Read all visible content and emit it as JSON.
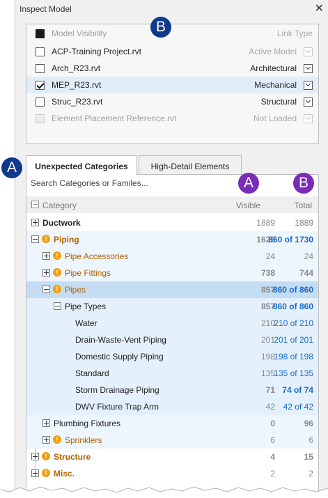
{
  "window": {
    "title": "Inspect Model",
    "close": "✕"
  },
  "models": {
    "header": {
      "label": "Model Visibility",
      "type": "Link Type"
    },
    "items": [
      {
        "name": "ACP-Training Project.rvt",
        "type": "Active Model"
      },
      {
        "name": "Arch_R23.rvt",
        "type": "Architectural"
      },
      {
        "name": "MEP_R23.rvt",
        "type": "Mechanical"
      },
      {
        "name": "Struc_R23.rvt",
        "type": "Structural"
      },
      {
        "name": "Element Placement Reference.rvt",
        "type": "Not Loaded"
      }
    ]
  },
  "tabs": [
    "Unexpected Categories",
    "High-Detail Elements"
  ],
  "search": {
    "placeholder": "Search Categories or Familes..."
  },
  "columns": {
    "category": "Category",
    "visible": "Visible",
    "total": "Total"
  },
  "rows": [
    {
      "label": "Ductwork",
      "visible": "1889",
      "total": "1889"
    },
    {
      "label": "Piping",
      "visible": "1625",
      "total": "860 of 1730"
    },
    {
      "label": "Pipe Accessories",
      "visible": "24",
      "total": "24"
    },
    {
      "label": "Pipe Fittings",
      "visible": "738",
      "total": "744"
    },
    {
      "label": "Pipes",
      "visible": "857",
      "total": "860 of 860"
    },
    {
      "label": "Pipe Types",
      "visible": "857",
      "total": "860 of 860"
    },
    {
      "label": "Water",
      "visible": "210",
      "total": "210 of 210"
    },
    {
      "label": "Drain-Waste-Vent Piping",
      "visible": "201",
      "total": "201 of 201"
    },
    {
      "label": "Domestic Supply Piping",
      "visible": "198",
      "total": "198 of 198"
    },
    {
      "label": "Standard",
      "visible": "135",
      "total": "135 of 135"
    },
    {
      "label": "Storm Drainage Piping",
      "visible": "71",
      "total": "74 of 74"
    },
    {
      "label": "DWV Fixture Trap Arm",
      "visible": "42",
      "total": "42 of 42"
    },
    {
      "label": "Plumbing Fixtures",
      "visible": "0",
      "total": "96"
    },
    {
      "label": "Sprinklers",
      "visible": "6",
      "total": "6"
    },
    {
      "label": "Structure",
      "visible": "4",
      "total": "15"
    },
    {
      "label": "Misc.",
      "visible": "2",
      "total": "2"
    }
  ],
  "callouts": {
    "a": "A",
    "b": "B"
  },
  "colors": {
    "badge_blue": "#0f3a8c",
    "badge_purple": "#7a2bb8",
    "warning": "#f0a010",
    "link_blue": "#1a6ac8",
    "category_orange": "#b06000",
    "selected_row": "#c4ddf3"
  }
}
